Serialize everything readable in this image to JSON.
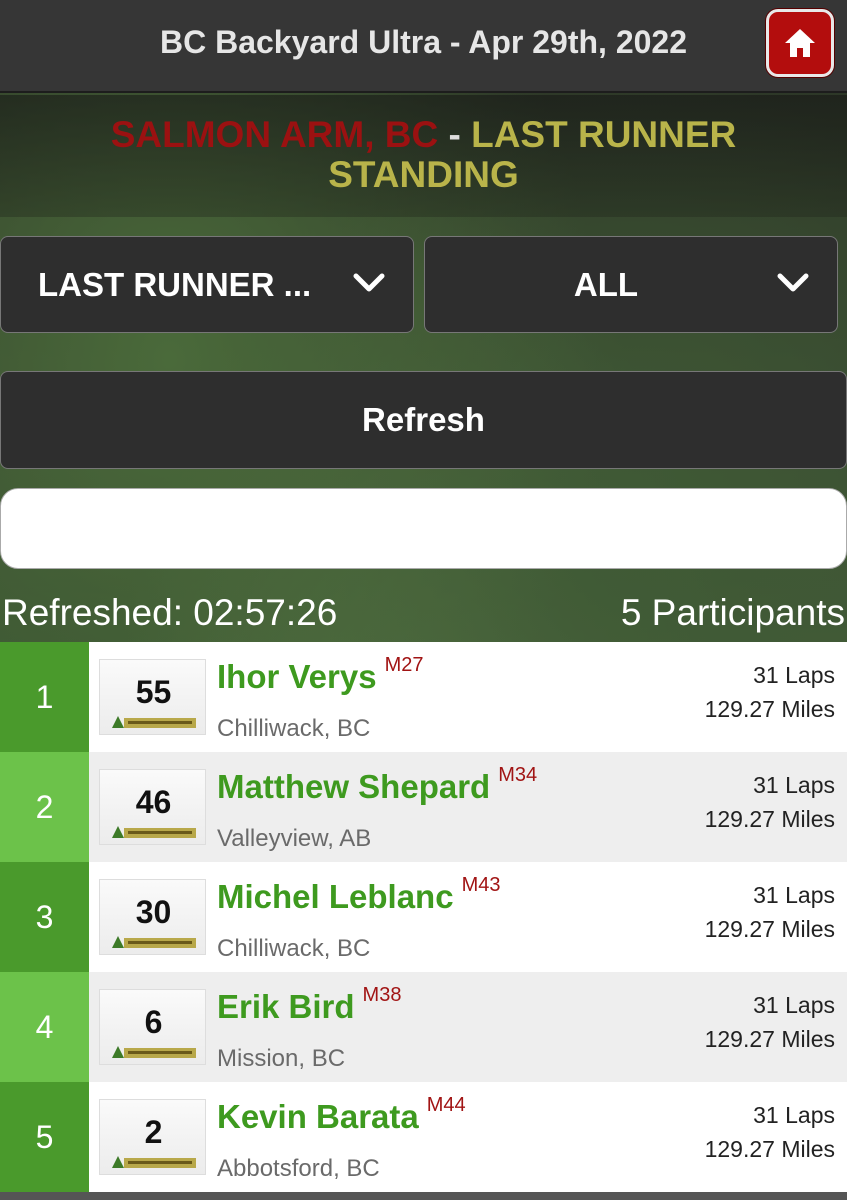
{
  "header": {
    "title": "BC Backyard Ultra - Apr 29th, 2022"
  },
  "banner": {
    "location": "SALMON ARM, BC",
    "separator": "-",
    "event": "LAST RUNNER STANDING"
  },
  "filters": {
    "race_select": {
      "value": "LAST RUNNER ..."
    },
    "group_select": {
      "value": "ALL"
    }
  },
  "refresh_label": "Refresh",
  "search": {
    "value": "",
    "placeholder": ""
  },
  "status": {
    "refreshed": "Refreshed: 02:57:26",
    "participants": "5 Participants"
  },
  "colors": {
    "accent_green": "#3e9a1f",
    "category_red": "#a11414",
    "home_red": "#b30d0d"
  },
  "runners": [
    {
      "rank": "1",
      "bib": "55",
      "name": "Ihor Verys",
      "category": "M27",
      "city": "Chilliwack, BC",
      "laps": "31 Laps",
      "miles": "129.27 Miles"
    },
    {
      "rank": "2",
      "bib": "46",
      "name": "Matthew Shepard",
      "category": "M34",
      "city": "Valleyview, AB",
      "laps": "31 Laps",
      "miles": "129.27 Miles"
    },
    {
      "rank": "3",
      "bib": "30",
      "name": "Michel Leblanc",
      "category": "M43",
      "city": "Chilliwack, BC",
      "laps": "31 Laps",
      "miles": "129.27 Miles"
    },
    {
      "rank": "4",
      "bib": "6",
      "name": "Erik Bird",
      "category": "M38",
      "city": "Mission, BC",
      "laps": "31 Laps",
      "miles": "129.27 Miles"
    },
    {
      "rank": "5",
      "bib": "2",
      "name": "Kevin Barata",
      "category": "M44",
      "city": "Abbotsford, BC",
      "laps": "31 Laps",
      "miles": "129.27 Miles"
    }
  ]
}
